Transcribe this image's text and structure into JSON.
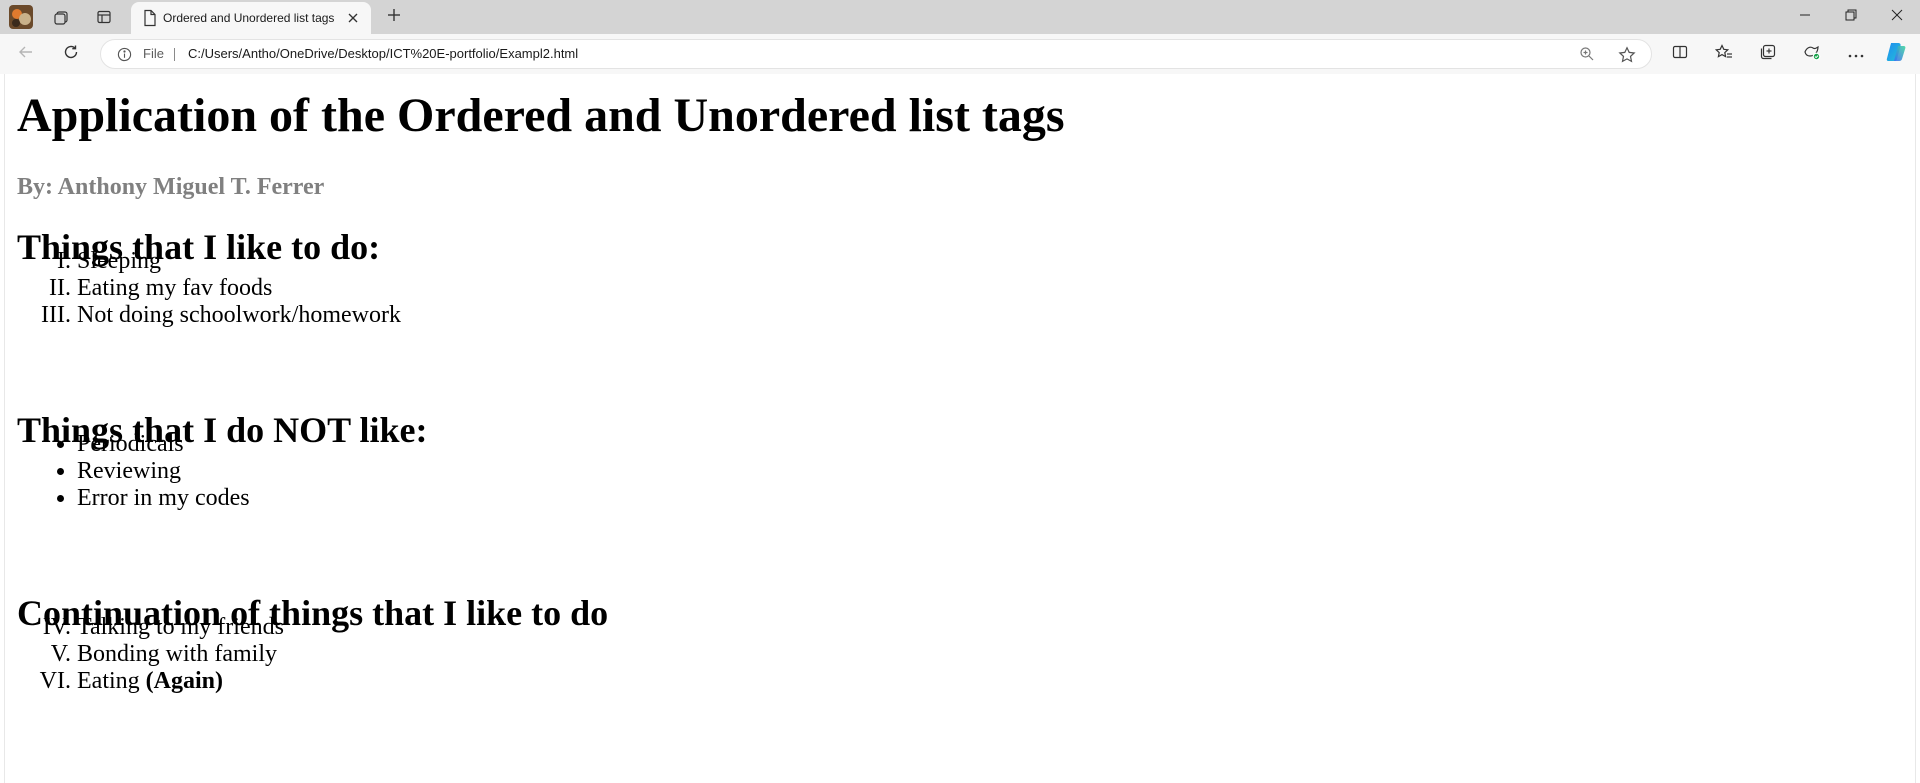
{
  "browser": {
    "tab": {
      "title": "Ordered and Unordered list tags"
    },
    "address": {
      "scheme_label": "File",
      "url": "C:/Users/Antho/OneDrive/Desktop/ICT%20E-portfolio/Exampl2.html"
    },
    "icons": {
      "profile": "profile-avatar",
      "workspaces": "workspaces-icon",
      "tab_actions": "vertical-tabs-icon",
      "page": "document-icon",
      "close": "close-icon",
      "new_tab": "plus-icon",
      "back": "back-arrow-icon",
      "refresh": "refresh-icon",
      "info": "info-icon",
      "zoom": "zoom-icon",
      "favorite": "star-icon",
      "split": "split-screen-icon",
      "favorites": "favorites-icon",
      "collections": "collections-icon",
      "security": "browser-essentials-icon",
      "more": "more-icon",
      "copilot": "copilot-icon",
      "minimize": "minimize-icon",
      "restore": "restore-icon",
      "window_close": "window-close-icon"
    },
    "colors": {
      "tabstrip": "#d4d4d4",
      "toolbar": "#f7f7f7",
      "accent_green": "#16a34a"
    }
  },
  "page": {
    "title": "Application of the Ordered and Unordered list tags",
    "byline": "By: Anthony Miguel T. Ferrer",
    "sections": [
      {
        "heading": "Things that I like to do:",
        "list_type": "ordered",
        "start": 1,
        "items": [
          "Sleeping",
          "Eating my fav foods",
          "Not doing schoolwork/homework"
        ]
      },
      {
        "heading": "Things that I do NOT like:",
        "list_type": "unordered",
        "items": [
          "Periodicals",
          "Reviewing",
          "Error in my codes"
        ]
      },
      {
        "heading": "Continuation of things that I like to do",
        "list_type": "ordered",
        "start": 4,
        "items": [
          "Talking to my friends",
          "Bonding with family"
        ],
        "last_item": {
          "prefix": "Eating ",
          "bold": "(Again)"
        }
      }
    ],
    "colors": {
      "byline": "#808080",
      "text": "#000000"
    }
  }
}
